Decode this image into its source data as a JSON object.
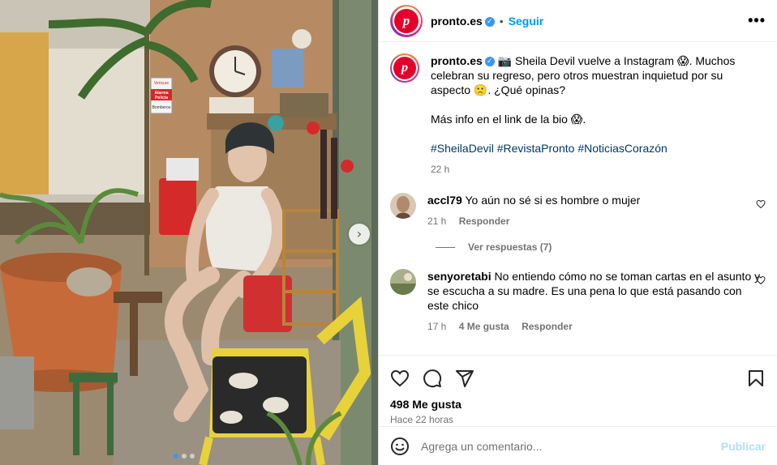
{
  "post": {
    "username": "pronto.es",
    "follow_label": "Seguir",
    "separator": "•",
    "more_label": "•••",
    "avatar_letter": "p"
  },
  "caption": {
    "username": "pronto.es",
    "line1": "📷 Sheila Devil vuelve a Instagram 😱. Muchos celebran su regreso, pero otros muestran inquietud por su aspecto 🙁. ¿Qué opinas?",
    "line2": "Más info en el link de la bio 😱.",
    "hashtags": "#SheilaDevil #RevistaPronto #NoticiasCorazón",
    "time": "22 h"
  },
  "comments": [
    {
      "username": "accl79",
      "text": "Yo aún no sé si es hombre o mujer",
      "time": "21 h",
      "likes": "",
      "reply_label": "Responder",
      "avatar_color": "#b08a6a"
    },
    {
      "username": "senyoretabi",
      "text": "No entiendo cómo no se toman cartas en el asunto y se escucha a su madre. Es una pena lo que está pasando con este chico",
      "time": "17 h",
      "likes": "4 Me gusta",
      "reply_label": "Responder",
      "avatar_color": "#7a8a5a"
    }
  ],
  "view_replies_label": "Ver respuestas (7)",
  "actions": {
    "likes": "498 Me gusta",
    "ago": "Hace 22 horas"
  },
  "add_comment": {
    "placeholder": "Agrega un comentario...",
    "publish_label": "Publicar"
  },
  "icons": {
    "like": "heart-icon",
    "comment": "comment-icon",
    "share": "send-icon",
    "save": "bookmark-icon",
    "emoji": "emoji-icon",
    "next": "chevron-right-icon",
    "verified": "verified-badge-icon",
    "more": "more-options-icon"
  },
  "photo_sign": {
    "brand": "Verisure",
    "line1": "Alarma",
    "line2": "Policía",
    "line3": "Bomberos"
  },
  "carousel": {
    "total": 3,
    "active": 0
  },
  "colors": {
    "accent": "#0095f6",
    "brand": "#e4002b",
    "muted": "#737373",
    "hashtag": "#00376b",
    "publish_disabled": "#b2dffc"
  }
}
